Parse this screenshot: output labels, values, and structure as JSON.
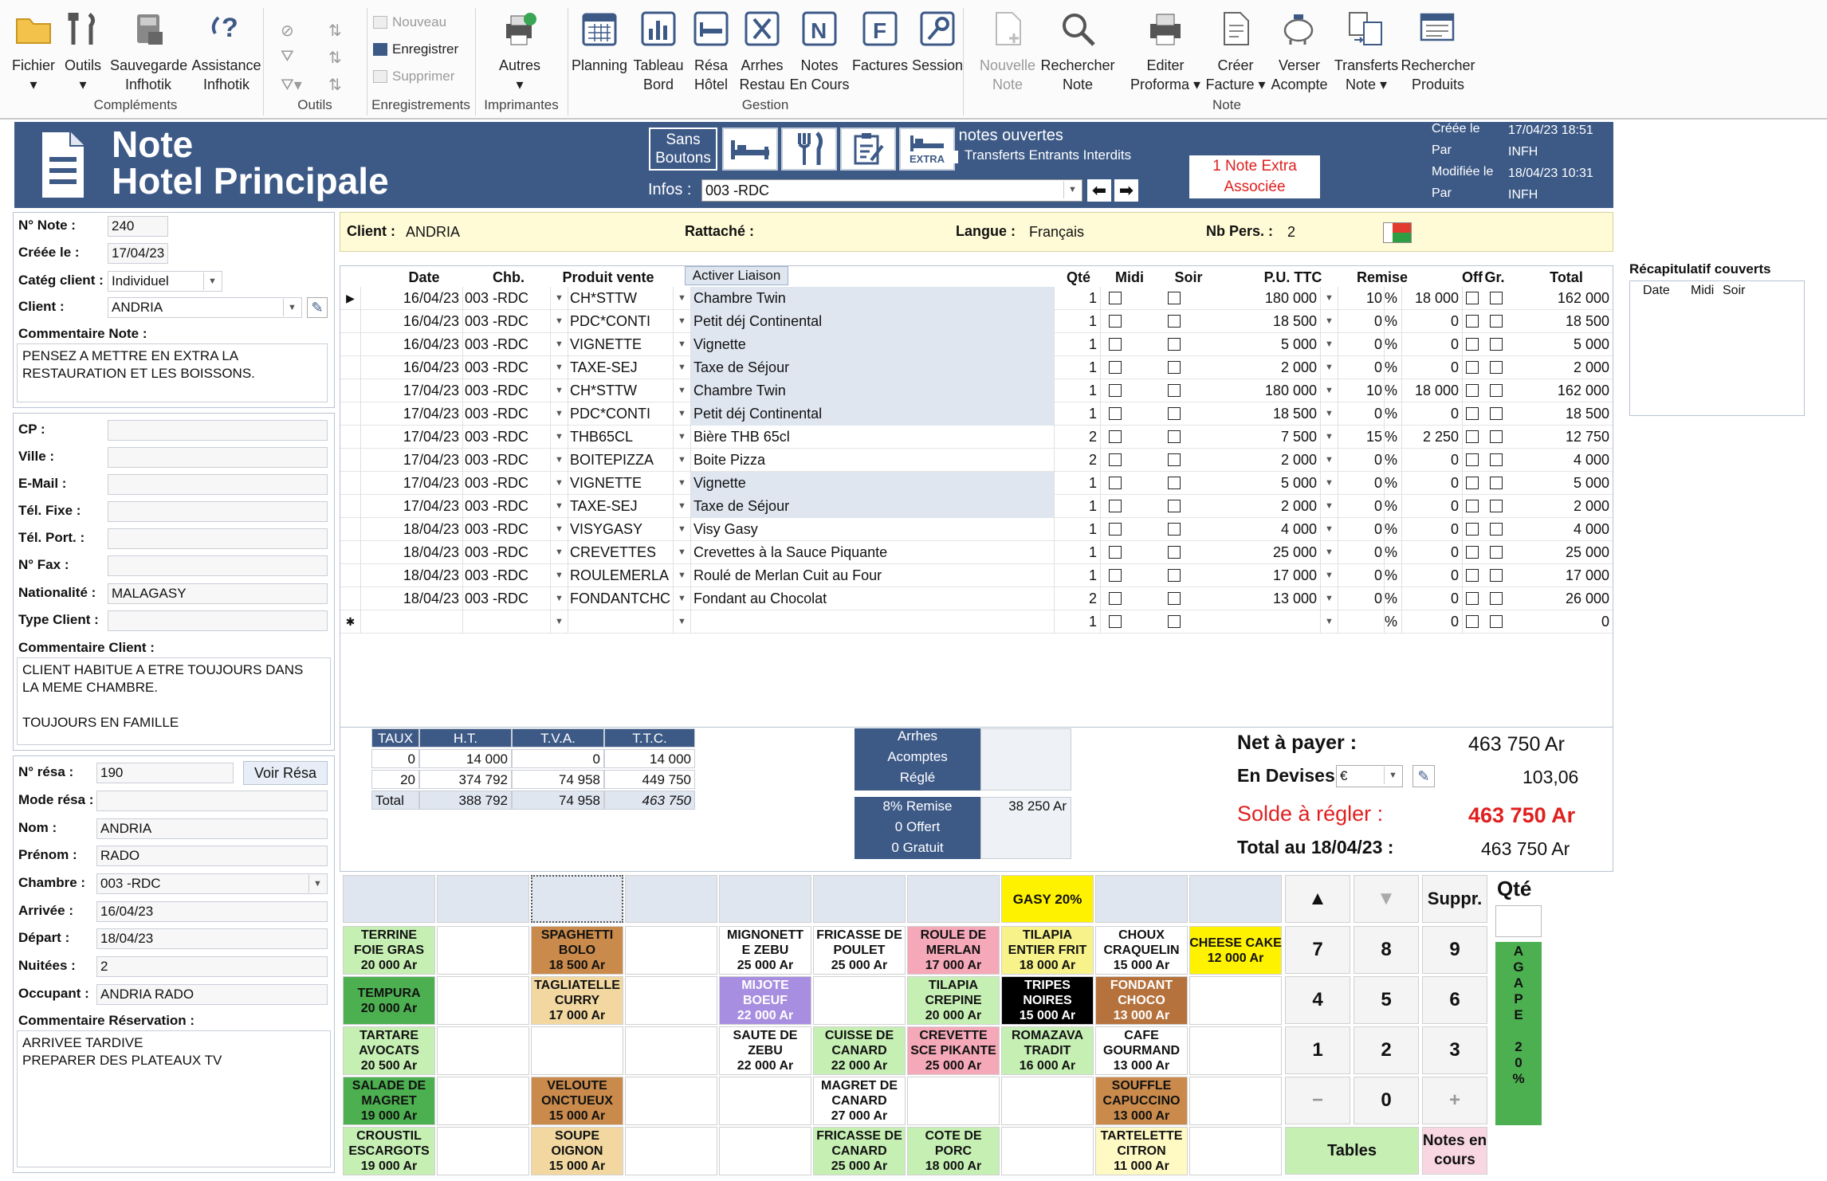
{
  "ribbon": {
    "buttons": [
      {
        "label": "Fichier\n▾",
        "icon": "folder-icon"
      },
      {
        "label": "Outils\n▾",
        "icon": "tools-icon"
      },
      {
        "label": "Sauvegarde\nInfhotik",
        "icon": "backup-icon"
      },
      {
        "label": "Assistance\nInfhotik",
        "icon": "help-icon"
      },
      {
        "label": "Autres\n▾",
        "icon": "printer-check-icon"
      },
      {
        "label": "Planning",
        "icon": "calendar-icon"
      },
      {
        "label": "Tableau\nBord",
        "icon": "bar-chart-icon"
      },
      {
        "label": "Résa\nHôtel",
        "icon": "hotel-icon"
      },
      {
        "label": "Arrhes\nRestau",
        "icon": "cutlery-icon"
      },
      {
        "label": "Notes\nEn Cours",
        "icon": "note-n-icon"
      },
      {
        "label": "Factures",
        "icon": "invoice-f-icon"
      },
      {
        "label": "Session",
        "icon": "key-icon"
      },
      {
        "label": "Nouvelle\nNote",
        "icon": "new-note-icon"
      },
      {
        "label": "Rechercher\nNote",
        "icon": "magnifier-icon"
      },
      {
        "label": "Editer\nProforma ▾",
        "icon": "printer-icon"
      },
      {
        "label": "Créer\nFacture ▾",
        "icon": "document-icon"
      },
      {
        "label": "Verser\nAcompte",
        "icon": "piggy-bank-icon"
      },
      {
        "label": "Transferts\nNote ▾",
        "icon": "transfer-icon"
      },
      {
        "label": "Rechercher\nProduits",
        "icon": "search-products-icon"
      }
    ],
    "small": {
      "nouveau": "Nouveau",
      "enregistrer": "Enregistrer",
      "supprimer": "Supprimer"
    },
    "groups": {
      "complements": "Compléments",
      "outils": "Outils",
      "enregistrements": "Enregistrements",
      "imprimantes": "Imprimantes",
      "gestion": "Gestion",
      "note": "Note"
    }
  },
  "header": {
    "title1": "Note",
    "title2": "Hotel Principale",
    "sans_boutons": "Sans\nBoutons",
    "extra": "EXTRA",
    "notes_ouvertes": "8 notes ouvertes",
    "transferts": "Transferts Entrants Interdits",
    "infos_label": "Infos :",
    "infos_value": "003 -RDC",
    "extra_note": "1 Note Extra\nAssociée",
    "creee_label": "Créée le",
    "creee_value": "17/04/23 18:51",
    "par1_label": "Par",
    "par1_value": "INFH",
    "modif_label": "Modifiée le",
    "modif_value": "18/04/23 10:31",
    "par2_label": "Par",
    "par2_value": "INFH"
  },
  "left": {
    "num_note_label": "N° Note :",
    "num_note": "240",
    "creee_label": "Créée le :",
    "creee": "17/04/23",
    "categ_label": "Catég client :",
    "categ": "Individuel",
    "client_label": "Client :",
    "client": "ANDRIA",
    "comment_note_label": "Commentaire Note :",
    "comment_note": "PENSEZ A METTRE EN EXTRA LA\nRESTAURATION ET LES BOISSONS.",
    "cp_label": "CP :",
    "ville_label": "Ville :",
    "email_label": "E-Mail :",
    "tel_fixe_label": "Tél. Fixe :",
    "tel_port_label": "Tél. Port. :",
    "fax_label": "N° Fax :",
    "nationalite_label": "Nationalité :",
    "nationalite": "MALAGASY",
    "type_client_label": "Type Client :",
    "comment_client_label": "Commentaire Client :",
    "comment_client": "CLIENT HABITUE A ETRE TOUJOURS DANS\nLA MEME CHAMBRE.\n\nTOUJOURS EN FAMILLE",
    "resa_label": "N° résa :",
    "resa": "190",
    "voir_resa": "Voir Résa",
    "mode_resa_label": "Mode résa :",
    "nom_label": "Nom :",
    "nom": "ANDRIA",
    "prenom_label": "Prénom :",
    "prenom": "RADO",
    "chambre_label": "Chambre :",
    "chambre": "003 -RDC",
    "arrivee_label": "Arrivée :",
    "arrivee": "16/04/23",
    "depart_label": "Départ :",
    "depart": "18/04/23",
    "nuitees_label": "Nuitées :",
    "nuitees": "2",
    "occupant_label": "Occupant :",
    "occupant": "ANDRIA RADO",
    "comment_resa_label": "Commentaire Réservation :",
    "comment_resa": "ARRIVEE TARDIVE\nPREPARER DES PLATEAUX TV"
  },
  "clientbar": {
    "client_label": "Client :",
    "client": "ANDRIA",
    "rattache_label": "Rattaché :",
    "langue_label": "Langue :",
    "langue": "Français",
    "nbpers_label": "Nb Pers. :",
    "nbpers": "2"
  },
  "grid": {
    "headers": {
      "date": "Date",
      "chb": "Chb.",
      "produit": "Produit vente",
      "activer": "Activer Liaison",
      "qte": "Qté",
      "midi": "Midi",
      "soir": "Soir",
      "pu": "P.U. TTC",
      "remise": "Remise",
      "off": "Off",
      "gr": "Gr.",
      "total": "Total"
    },
    "rows": [
      {
        "date": "16/04/23",
        "chb": "003 -RDC",
        "code": "CH*STTW",
        "libelle": "Chambre Twin",
        "qte": "1",
        "pu": "180 000",
        "remise": "10",
        "pct": "%",
        "rem_val": "18 000",
        "total": "162 000",
        "hl": true
      },
      {
        "date": "16/04/23",
        "chb": "003 -RDC",
        "code": "PDC*CONTI",
        "libelle": "Petit déj Continental",
        "qte": "1",
        "pu": "18 500",
        "remise": "0",
        "pct": "%",
        "rem_val": "0",
        "total": "18 500",
        "hl": true
      },
      {
        "date": "16/04/23",
        "chb": "003 -RDC",
        "code": "VIGNETTE",
        "libelle": "Vignette",
        "qte": "1",
        "pu": "5 000",
        "remise": "0",
        "pct": "%",
        "rem_val": "0",
        "total": "5 000",
        "hl": true
      },
      {
        "date": "16/04/23",
        "chb": "003 -RDC",
        "code": "TAXE-SEJ",
        "libelle": "Taxe de Séjour",
        "qte": "1",
        "pu": "2 000",
        "remise": "0",
        "pct": "%",
        "rem_val": "0",
        "total": "2 000",
        "hl": true
      },
      {
        "date": "17/04/23",
        "chb": "003 -RDC",
        "code": "CH*STTW",
        "libelle": "Chambre Twin",
        "qte": "1",
        "pu": "180 000",
        "remise": "10",
        "pct": "%",
        "rem_val": "18 000",
        "total": "162 000",
        "hl": true
      },
      {
        "date": "17/04/23",
        "chb": "003 -RDC",
        "code": "PDC*CONTI",
        "libelle": "Petit déj Continental",
        "qte": "1",
        "pu": "18 500",
        "remise": "0",
        "pct": "%",
        "rem_val": "0",
        "total": "18 500",
        "hl": true
      },
      {
        "date": "17/04/23",
        "chb": "003 -RDC",
        "code": "THB65CL",
        "libelle": "Bière THB 65cl",
        "qte": "2",
        "pu": "7 500",
        "remise": "15",
        "pct": "%",
        "rem_val": "2 250",
        "total": "12 750",
        "hl": false
      },
      {
        "date": "17/04/23",
        "chb": "003 -RDC",
        "code": "BOITEPIZZA",
        "libelle": "Boite Pizza",
        "qte": "2",
        "pu": "2 000",
        "remise": "0",
        "pct": "%",
        "rem_val": "0",
        "total": "4 000",
        "hl": false
      },
      {
        "date": "17/04/23",
        "chb": "003 -RDC",
        "code": "VIGNETTE",
        "libelle": "Vignette",
        "qte": "1",
        "pu": "5 000",
        "remise": "0",
        "pct": "%",
        "rem_val": "0",
        "total": "5 000",
        "hl": true
      },
      {
        "date": "17/04/23",
        "chb": "003 -RDC",
        "code": "TAXE-SEJ",
        "libelle": "Taxe de Séjour",
        "qte": "1",
        "pu": "2 000",
        "remise": "0",
        "pct": "%",
        "rem_val": "0",
        "total": "2 000",
        "hl": true
      },
      {
        "date": "18/04/23",
        "chb": "003 -RDC",
        "code": "VISYGASY",
        "libelle": "Visy Gasy",
        "qte": "1",
        "pu": "4 000",
        "remise": "0",
        "pct": "%",
        "rem_val": "0",
        "total": "4 000",
        "hl": false
      },
      {
        "date": "18/04/23",
        "chb": "003 -RDC",
        "code": "CREVETTES",
        "libelle": "Crevettes à la Sauce Piquante",
        "qte": "1",
        "pu": "25 000",
        "remise": "0",
        "pct": "%",
        "rem_val": "0",
        "total": "25 000",
        "hl": false
      },
      {
        "date": "18/04/23",
        "chb": "003 -RDC",
        "code": "ROULEMERLA",
        "libelle": "Roulé de Merlan Cuit au Four",
        "qte": "1",
        "pu": "17 000",
        "remise": "0",
        "pct": "%",
        "rem_val": "0",
        "total": "17 000",
        "hl": false
      },
      {
        "date": "18/04/23",
        "chb": "003 -RDC",
        "code": "FONDANTCHC",
        "libelle": "Fondant au Chocolat",
        "qte": "2",
        "pu": "13 000",
        "remise": "0",
        "pct": "%",
        "rem_val": "0",
        "total": "26 000",
        "hl": false
      },
      {
        "date": "",
        "chb": "",
        "code": "",
        "libelle": "",
        "qte": "1",
        "pu": "",
        "remise": "",
        "pct": "%",
        "rem_val": "0",
        "total": "0",
        "hl": false,
        "new": true
      }
    ]
  },
  "recap": {
    "title": "Récapitulatif couverts",
    "date": "Date",
    "midi": "Midi",
    "soir": "Soir"
  },
  "tva": {
    "headers": [
      "TAUX",
      "H.T.",
      "T.V.A.",
      "T.T.C."
    ],
    "rows": [
      [
        "0",
        "14 000",
        "0",
        "14 000"
      ],
      [
        "20",
        "374 792",
        "74 958",
        "449 750"
      ]
    ],
    "total": [
      "Total",
      "388 792",
      "74 958",
      "463 750"
    ]
  },
  "arrhes": {
    "arrhes": "Arrhes",
    "acomptes": "Acomptes",
    "regle": "Réglé",
    "remise": "8% Remise",
    "remise_val": "38 250 Ar",
    "offert": "0 Offert",
    "gratuit": "0 Gratuit"
  },
  "totals": {
    "net_label": "Net à payer :",
    "net": "463 750 Ar",
    "devises_label": "En Devises :",
    "devise": "€",
    "devise_val": "103,06",
    "solde_label": "Solde à régler :",
    "solde": "463 750 Ar",
    "total_au_label": "Total au 18/04/23 :",
    "total_au": "463 750 Ar"
  },
  "categories": [
    "",
    "",
    "",
    "",
    "",
    "",
    "",
    "GASY 20%",
    "",
    ""
  ],
  "products": [
    [
      {
        "t": "TERRINE\nFOIE GRAS\n20 000 Ar",
        "c": "#c6efb4"
      },
      {
        "t": "",
        "c": "#fff"
      },
      {
        "t": "SPAGHETTI\nBOLO\n18 500 Ar",
        "c": "#c98a4b"
      },
      {
        "t": "",
        "c": "#fff"
      },
      {
        "t": "MIGNONETT\nE ZEBU\n25 000 Ar",
        "c": "#fff"
      },
      {
        "t": "FRICASSE DE\nPOULET\n25 000 Ar",
        "c": "#fff"
      },
      {
        "t": "ROULE DE\nMERLAN\n17 000 Ar",
        "c": "#f4a8b8"
      },
      {
        "t": "TILAPIA\nENTIER FRIT\n18 000 Ar",
        "c": "#f7f28a"
      },
      {
        "t": "CHOUX\nCRAQUELIN\n15 000 Ar",
        "c": "#fff"
      },
      {
        "t": "CHEESE CAKE\n12 000 Ar",
        "c": "#fff200"
      }
    ],
    [
      {
        "t": "TEMPURA\n20 000 Ar",
        "c": "#4caf50"
      },
      {
        "t": "",
        "c": "#fff"
      },
      {
        "t": "TAGLIATELLE\nCURRY\n17 000 Ar",
        "c": "#f2d8a0"
      },
      {
        "t": "",
        "c": "#fff"
      },
      {
        "t": "MIJOTE\nBOEUF\n22 000 Ar",
        "c": "#a88ee0"
      },
      {
        "t": "",
        "c": "#fff"
      },
      {
        "t": "TILAPIA\nCREPINE\n20 000 Ar",
        "c": "#c6efb4"
      },
      {
        "t": "TRIPES\nNOIRES\n15 000 Ar",
        "c": "#000"
      },
      {
        "t": "FONDANT\nCHOCO\n13 000 Ar",
        "c": "#b5723d"
      },
      {
        "t": "",
        "c": "#fff"
      }
    ],
    [
      {
        "t": "TARTARE\nAVOCATS\n20 500 Ar",
        "c": "#c6efb4"
      },
      {
        "t": "",
        "c": "#fff"
      },
      {
        "t": "",
        "c": "#fff"
      },
      {
        "t": "",
        "c": "#fff"
      },
      {
        "t": "SAUTE DE\nZEBU\n22 000 Ar",
        "c": "#fff"
      },
      {
        "t": "CUISSE DE\nCANARD\n22 000 Ar",
        "c": "#c6efb4"
      },
      {
        "t": "CREVETTE\nSCE PIKANTE\n25 000 Ar",
        "c": "#f4a8b8"
      },
      {
        "t": "ROMAZAVA\nTRADIT\n16 000 Ar",
        "c": "#c6efb4"
      },
      {
        "t": "CAFE\nGOURMAND\n13 000 Ar",
        "c": "#fff"
      },
      {
        "t": "",
        "c": "#fff"
      }
    ],
    [
      {
        "t": "SALADE DE\nMAGRET\n19 000 Ar",
        "c": "#4caf50"
      },
      {
        "t": "",
        "c": "#fff"
      },
      {
        "t": "VELOUTE\nONCTUEUX\n15 000 Ar",
        "c": "#c98a4b"
      },
      {
        "t": "",
        "c": "#fff"
      },
      {
        "t": "",
        "c": "#fff"
      },
      {
        "t": "MAGRET DE\nCANARD\n27 000 Ar",
        "c": "#fff"
      },
      {
        "t": "",
        "c": "#fff"
      },
      {
        "t": "",
        "c": "#fff"
      },
      {
        "t": "SOUFFLE\nCAPUCCINO\n13 000 Ar",
        "c": "#c98a4b"
      },
      {
        "t": "",
        "c": "#fff"
      }
    ],
    [
      {
        "t": "CROUSTIL\nESCARGOTS\n19 000 Ar",
        "c": "#c6efb4"
      },
      {
        "t": "",
        "c": "#fff"
      },
      {
        "t": "SOUPE\nOIGNON\n15 000 Ar",
        "c": "#f2d8a0"
      },
      {
        "t": "",
        "c": "#fff"
      },
      {
        "t": "",
        "c": "#fff"
      },
      {
        "t": "FRICASSE DE\nCANARD\n25 000 Ar",
        "c": "#c6efb4"
      },
      {
        "t": "COTE DE\nPORC\n18 000 Ar",
        "c": "#c6efb4"
      },
      {
        "t": "",
        "c": "#fff"
      },
      {
        "t": "TARTELETTE\nCITRON\n11 000 Ar",
        "c": "#fff9c4"
      },
      {
        "t": "",
        "c": "#fff"
      }
    ]
  ],
  "keypad": {
    "keys": [
      [
        "▲",
        "▼",
        "Suppr."
      ],
      [
        "7",
        "8",
        "9"
      ],
      [
        "4",
        "5",
        "6"
      ],
      [
        "1",
        "2",
        "3"
      ],
      [
        "−",
        "0",
        "+"
      ]
    ],
    "tables": "Tables",
    "notes_en_cours": "Notes en\ncours",
    "qte": "Qté",
    "agape": "A\nG\nA\nP\nE\n\n2\n0\n%"
  }
}
